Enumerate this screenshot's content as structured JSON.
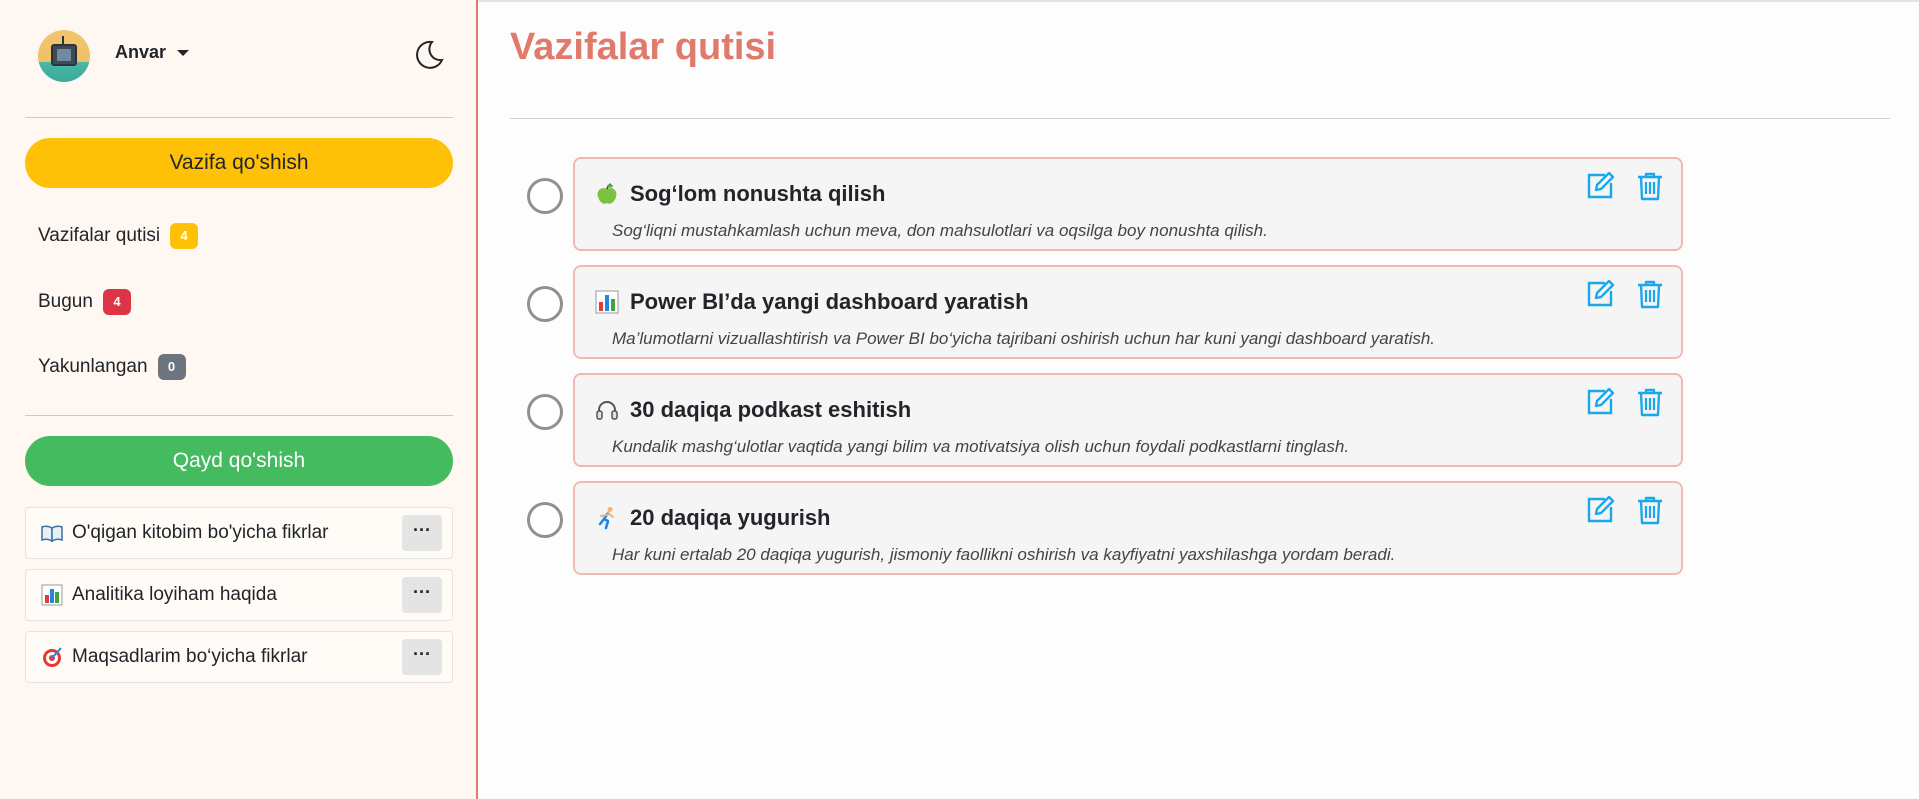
{
  "user": {
    "name": "Anvar"
  },
  "sidebar": {
    "add_task_label": "Vazifa qo'shish",
    "nav": [
      {
        "label": "Vazifalar qutisi",
        "count": "4",
        "color": "#ffc107"
      },
      {
        "label": "Bugun",
        "count": "4",
        "color": "#dc3545"
      },
      {
        "label": "Yakunlangan",
        "count": "0",
        "color": "#6c757d"
      }
    ],
    "add_note_label": "Qayd qo'shish",
    "notes": [
      {
        "icon": "open-book-icon",
        "label": "O'qigan kitobim bo'yicha fikrlar",
        "menu": "···"
      },
      {
        "icon": "bar-chart-icon",
        "label": "Analitika loyiham haqida",
        "menu": "···"
      },
      {
        "icon": "target-icon",
        "label": "Maqsadlarim bo‘yicha fikrlar",
        "menu": "···"
      }
    ]
  },
  "main": {
    "title": "Vazifalar qutisi",
    "tasks": [
      {
        "icon": "green-apple-icon",
        "title": "Sog‘lom nonushta qilish",
        "description": "Sog‘liqni mustahkamlash uchun meva, don mahsulotlari va oqsilga boy nonushta qilish."
      },
      {
        "icon": "bar-chart-icon",
        "title": "Power BI’da yangi dashboard yaratish",
        "description": "Ma’lumotlarni vizuallashtirish va Power BI bo‘yicha tajribani oshirish uchun har kuni yangi dashboard yaratish."
      },
      {
        "icon": "headphones-icon",
        "title": "30 daqiqa podkast eshitish",
        "description": "Kundalik mashg‘ulotlar vaqtida yangi bilim va motivatsiya olish uchun foydali podkastlarni tinglash."
      },
      {
        "icon": "runner-icon",
        "title": "20 daqiqa yugurish",
        "description": "Har kuni ertalab 20 daqiqa yugurish, jismoniy faollikni oshirish va kayfiyatni yaxshilashga yordam beradi."
      }
    ]
  },
  "colors": {
    "accent": "#e07a6b",
    "warning": "#ffc107",
    "success": "#44bb5f",
    "action": "#1ca7ec"
  }
}
